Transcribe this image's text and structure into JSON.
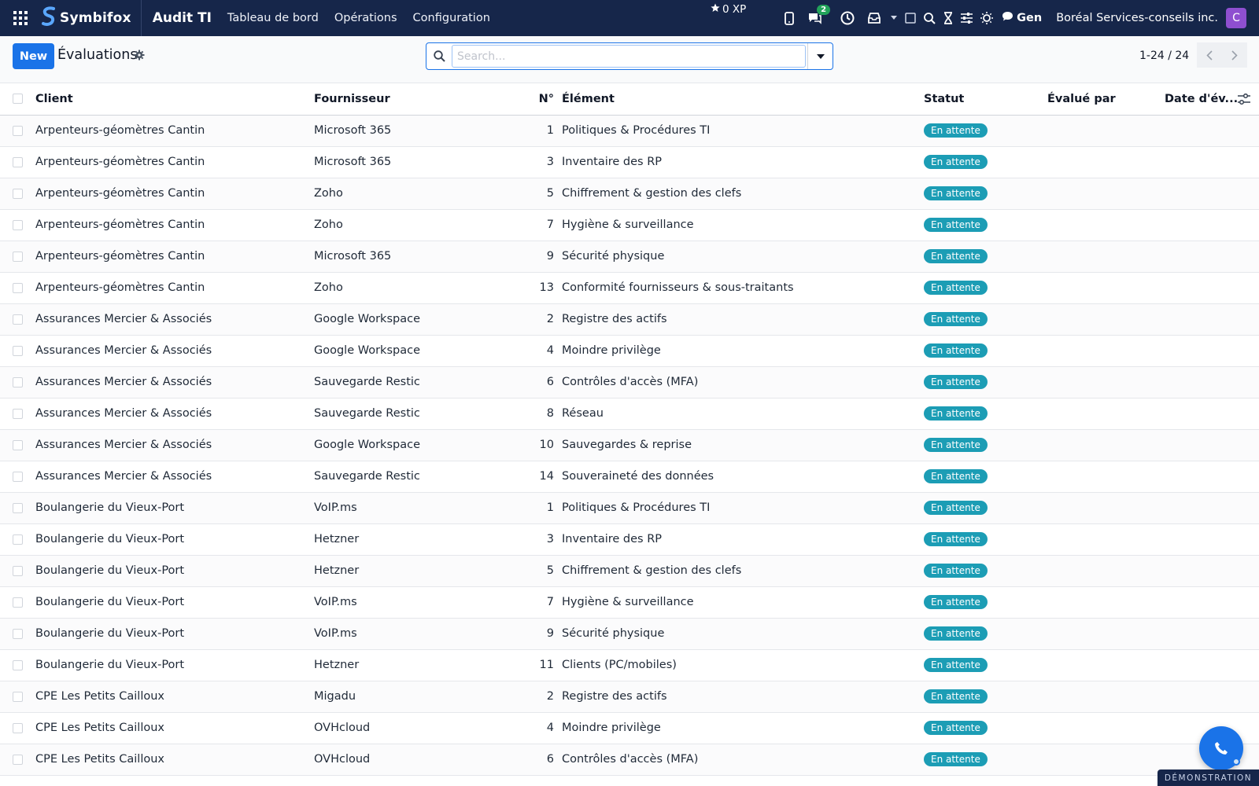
{
  "navbar": {
    "brand": "Symbifox",
    "app_title": "Audit TI",
    "menu": [
      "Tableau de bord",
      "Opérations",
      "Configuration"
    ],
    "xp": "0 XP",
    "chat_count": "2",
    "gen_label": "Gen",
    "company": "Boréal Services-conseils inc.",
    "avatar_letter": "C"
  },
  "control": {
    "new_label": "New",
    "title": "Évaluations",
    "search_placeholder": "Search...",
    "pager": "1-24 / 24"
  },
  "table": {
    "columns": [
      "Client",
      "Fournisseur",
      "N°",
      "Élément",
      "Statut",
      "Évalué par",
      "Date d'év..."
    ],
    "rows": [
      {
        "client": "Arpenteurs-géomètres Cantin",
        "supplier": "Microsoft 365",
        "num": "1",
        "element": "Politiques & Procédures TI",
        "status": "En attente"
      },
      {
        "client": "Arpenteurs-géomètres Cantin",
        "supplier": "Microsoft 365",
        "num": "3",
        "element": "Inventaire des RP",
        "status": "En attente"
      },
      {
        "client": "Arpenteurs-géomètres Cantin",
        "supplier": "Zoho",
        "num": "5",
        "element": "Chiffrement & gestion des clefs",
        "status": "En attente"
      },
      {
        "client": "Arpenteurs-géomètres Cantin",
        "supplier": "Zoho",
        "num": "7",
        "element": "Hygiène & surveillance",
        "status": "En attente"
      },
      {
        "client": "Arpenteurs-géomètres Cantin",
        "supplier": "Microsoft 365",
        "num": "9",
        "element": "Sécurité physique",
        "status": "En attente"
      },
      {
        "client": "Arpenteurs-géomètres Cantin",
        "supplier": "Zoho",
        "num": "13",
        "element": "Conformité fournisseurs & sous-traitants",
        "status": "En attente"
      },
      {
        "client": "Assurances Mercier & Associés",
        "supplier": "Google Workspace",
        "num": "2",
        "element": "Registre des actifs",
        "status": "En attente"
      },
      {
        "client": "Assurances Mercier & Associés",
        "supplier": "Google Workspace",
        "num": "4",
        "element": "Moindre privilège",
        "status": "En attente"
      },
      {
        "client": "Assurances Mercier & Associés",
        "supplier": "Sauvegarde Restic",
        "num": "6",
        "element": "Contrôles d'accès (MFA)",
        "status": "En attente"
      },
      {
        "client": "Assurances Mercier & Associés",
        "supplier": "Sauvegarde Restic",
        "num": "8",
        "element": "Réseau",
        "status": "En attente"
      },
      {
        "client": "Assurances Mercier & Associés",
        "supplier": "Google Workspace",
        "num": "10",
        "element": "Sauvegardes & reprise",
        "status": "En attente"
      },
      {
        "client": "Assurances Mercier & Associés",
        "supplier": "Sauvegarde Restic",
        "num": "14",
        "element": "Souveraineté des données",
        "status": "En attente"
      },
      {
        "client": "Boulangerie du Vieux-Port",
        "supplier": "VoIP.ms",
        "num": "1",
        "element": "Politiques & Procédures TI",
        "status": "En attente"
      },
      {
        "client": "Boulangerie du Vieux-Port",
        "supplier": "Hetzner",
        "num": "3",
        "element": "Inventaire des RP",
        "status": "En attente"
      },
      {
        "client": "Boulangerie du Vieux-Port",
        "supplier": "Hetzner",
        "num": "5",
        "element": "Chiffrement & gestion des clefs",
        "status": "En attente"
      },
      {
        "client": "Boulangerie du Vieux-Port",
        "supplier": "VoIP.ms",
        "num": "7",
        "element": "Hygiène & surveillance",
        "status": "En attente"
      },
      {
        "client": "Boulangerie du Vieux-Port",
        "supplier": "VoIP.ms",
        "num": "9",
        "element": "Sécurité physique",
        "status": "En attente"
      },
      {
        "client": "Boulangerie du Vieux-Port",
        "supplier": "Hetzner",
        "num": "11",
        "element": "Clients (PC/mobiles)",
        "status": "En attente"
      },
      {
        "client": "CPE Les Petits Cailloux",
        "supplier": "Migadu",
        "num": "2",
        "element": "Registre des actifs",
        "status": "En attente"
      },
      {
        "client": "CPE Les Petits Cailloux",
        "supplier": "OVHcloud",
        "num": "4",
        "element": "Moindre privilège",
        "status": "En attente"
      },
      {
        "client": "CPE Les Petits Cailloux",
        "supplier": "OVHcloud",
        "num": "6",
        "element": "Contrôles d'accès (MFA)",
        "status": "En attente"
      }
    ]
  },
  "demo_label": "DÉMONSTRATION",
  "colors": {
    "navbar_bg": "#16264a",
    "primary": "#1a73e8",
    "status_badge": "#1c9db5",
    "avatar": "#8e4fd0",
    "chat_badge": "#22a35a"
  },
  "icons": [
    "apps-grid-icon",
    "symbifox-logo",
    "star-icon",
    "phone-icon",
    "chat-icon",
    "clock-icon",
    "inbox-icon",
    "caret-down-icon",
    "square-icon",
    "search-icon",
    "hourglass-icon",
    "sliders-icon",
    "sun-icon",
    "comment-icon",
    "gear-icon",
    "chevron-left-icon",
    "chevron-right-icon",
    "column-settings-icon",
    "phone-call-icon"
  ]
}
